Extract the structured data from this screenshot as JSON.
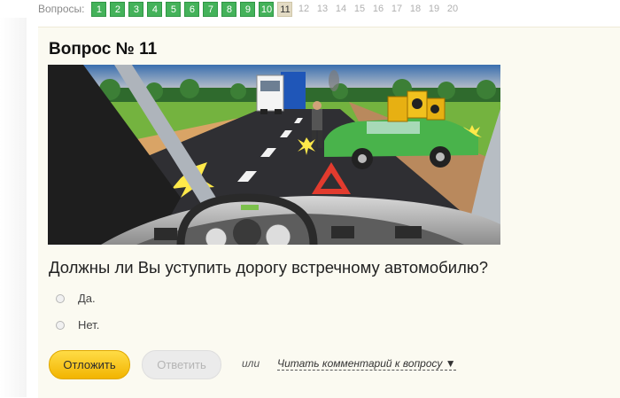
{
  "nav": {
    "label": "Вопросы:",
    "items": [
      {
        "label": "1",
        "state": "done"
      },
      {
        "label": "2",
        "state": "done"
      },
      {
        "label": "3",
        "state": "done"
      },
      {
        "label": "4",
        "state": "done"
      },
      {
        "label": "5",
        "state": "done"
      },
      {
        "label": "6",
        "state": "done"
      },
      {
        "label": "7",
        "state": "done"
      },
      {
        "label": "8",
        "state": "done"
      },
      {
        "label": "9",
        "state": "done"
      },
      {
        "label": "10",
        "state": "done"
      },
      {
        "label": "11",
        "state": "current"
      },
      {
        "label": "12",
        "state": "todo"
      },
      {
        "label": "13",
        "state": "todo"
      },
      {
        "label": "14",
        "state": "todo"
      },
      {
        "label": "15",
        "state": "todo"
      },
      {
        "label": "16",
        "state": "todo"
      },
      {
        "label": "17",
        "state": "todo"
      },
      {
        "label": "18",
        "state": "todo"
      },
      {
        "label": "19",
        "state": "todo"
      },
      {
        "label": "20",
        "state": "todo"
      }
    ]
  },
  "question": {
    "title": "Вопрос № 11",
    "text": "Должны ли Вы уступить дорогу встречному автомобилю?",
    "options": [
      "Да.",
      "Нет."
    ]
  },
  "actions": {
    "postpone_label": "Отложить",
    "answer_label": "Ответить",
    "or_label": "или",
    "comments_label": "Читать комментарий к вопросу ▼"
  },
  "colors": {
    "done": "#44b25a",
    "current": "#e3dbc4",
    "postpone": "#f5c20c",
    "panel": "#fbfaf1"
  }
}
